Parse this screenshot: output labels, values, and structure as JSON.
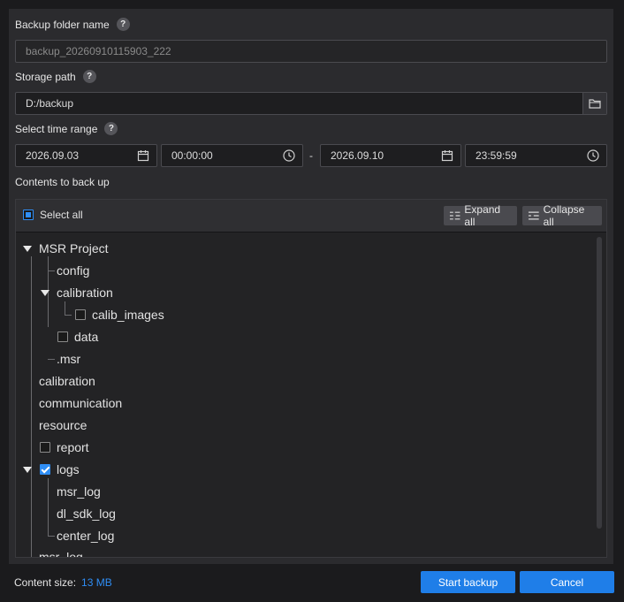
{
  "backup_name": {
    "label": "Backup folder name",
    "value": "backup_20260910115903_222"
  },
  "storage": {
    "label": "Storage path",
    "value": "D:/backup"
  },
  "time_range": {
    "label": "Select time range",
    "start_date": "2026.09.03",
    "start_time": "00:00:00",
    "separator": "-",
    "end_date": "2026.09.10",
    "end_time": "23:59:59"
  },
  "contents": {
    "label": "Contents to back up",
    "select_all": "Select all",
    "expand_all": "Expand all",
    "collapse_all": "Collapse all",
    "tree": [
      {
        "label": "MSR Project"
      },
      {
        "label": "config"
      },
      {
        "label": "calibration"
      },
      {
        "label": "calib_images"
      },
      {
        "label": "data"
      },
      {
        "label": ".msr"
      },
      {
        "label": "calibration"
      },
      {
        "label": "communication"
      },
      {
        "label": "resource"
      },
      {
        "label": "report"
      },
      {
        "label": "logs"
      },
      {
        "label": "msr_log"
      },
      {
        "label": "dl_sdk_log"
      },
      {
        "label": "center_log"
      },
      {
        "label": "msr_log"
      }
    ]
  },
  "footer": {
    "size_label": "Content size:",
    "size_value": "13 MB",
    "start": "Start backup",
    "cancel": "Cancel"
  },
  "help_glyph": "?",
  "colors": {
    "accent": "#1f7ee8",
    "panel": "#2b2b2e"
  }
}
